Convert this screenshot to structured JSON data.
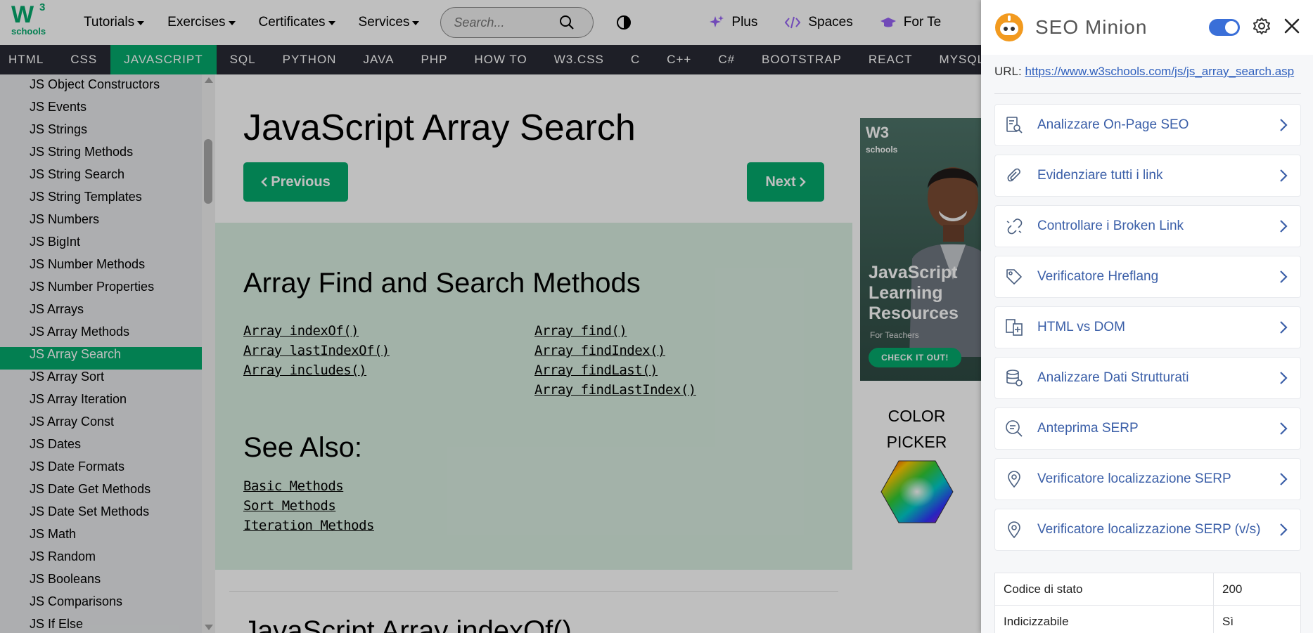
{
  "topnav": {
    "logo_main": "W",
    "logo_sup": "3",
    "logo_sub": "schools",
    "menus": [
      "Tutorials",
      "Exercises",
      "Certificates",
      "Services"
    ],
    "search_placeholder": "Search...",
    "plus": "Plus",
    "spaces": "Spaces",
    "teachers": "For Te"
  },
  "subjects": [
    "HTML",
    "CSS",
    "JAVASCRIPT",
    "SQL",
    "PYTHON",
    "JAVA",
    "PHP",
    "HOW TO",
    "W3.CSS",
    "C",
    "C++",
    "C#",
    "BOOTSTRAP",
    "REACT",
    "MYSQL"
  ],
  "active_subject": "JAVASCRIPT",
  "sidebar": {
    "items": [
      "JS Object Constructors",
      "JS Events",
      "JS Strings",
      "JS String Methods",
      "JS String Search",
      "JS String Templates",
      "JS Numbers",
      "JS BigInt",
      "JS Number Methods",
      "JS Number Properties",
      "JS Arrays",
      "JS Array Methods",
      "JS Array Search",
      "JS Array Sort",
      "JS Array Iteration",
      "JS Array Const",
      "JS Dates",
      "JS Date Formats",
      "JS Date Get Methods",
      "JS Date Set Methods",
      "JS Math",
      "JS Random",
      "JS Booleans",
      "JS Comparisons",
      "JS If Else"
    ],
    "active": "JS Array Search"
  },
  "main": {
    "title": "JavaScript Array Search",
    "prev": "Previous",
    "next": "Next",
    "heading": "Array Find and Search Methods",
    "links_col1": [
      "Array indexOf()",
      "Array lastIndexOf()",
      "Array includes()"
    ],
    "links_col2": [
      "Array find()",
      "Array findIndex()",
      "Array findLast()",
      "Array findLastIndex()"
    ],
    "see_also": "See Also:",
    "see_also_links": [
      "Basic Methods",
      "Sort Methods",
      "Iteration Methods"
    ],
    "next_section_title": "JavaScript Array indexOf()"
  },
  "ad": {
    "brand": "W3",
    "brand_sub": "schools",
    "headline": "JavaScript Learning Resources",
    "sub": "For Teachers",
    "cta": "CHECK IT OUT!"
  },
  "color_picker": {
    "line1": "COLOR",
    "line2": "PICKER"
  },
  "seo_panel": {
    "title": "SEO Minion",
    "url_label": "URL:",
    "url": "https://www.w3schools.com/js/js_array_search.asp",
    "toggle_on": true,
    "accent": "#3a6fd8",
    "menu": [
      {
        "label": "Analizzare On-Page SEO",
        "icon": "page-search-icon"
      },
      {
        "label": "Evidenziare tutti i link",
        "icon": "paperclip-icon"
      },
      {
        "label": "Controllare i Broken Link",
        "icon": "broken-link-icon"
      },
      {
        "label": "Verificatore Hreflang",
        "icon": "tag-icon"
      },
      {
        "label": "HTML vs DOM",
        "icon": "compare-icon"
      },
      {
        "label": "Analizzare Dati Strutturati",
        "icon": "database-icon"
      },
      {
        "label": "Anteprima SERP",
        "icon": "search-bubble-icon"
      },
      {
        "label": "Verificatore localizzazione SERP",
        "icon": "location-pin-icon"
      },
      {
        "label": "Verificatore localizzazione SERP (v/s)",
        "icon": "location-pin-icon"
      }
    ],
    "stats": [
      {
        "key": "Codice di stato",
        "value": "200"
      },
      {
        "key": "Indicizzabile",
        "value": "Sì"
      }
    ]
  }
}
